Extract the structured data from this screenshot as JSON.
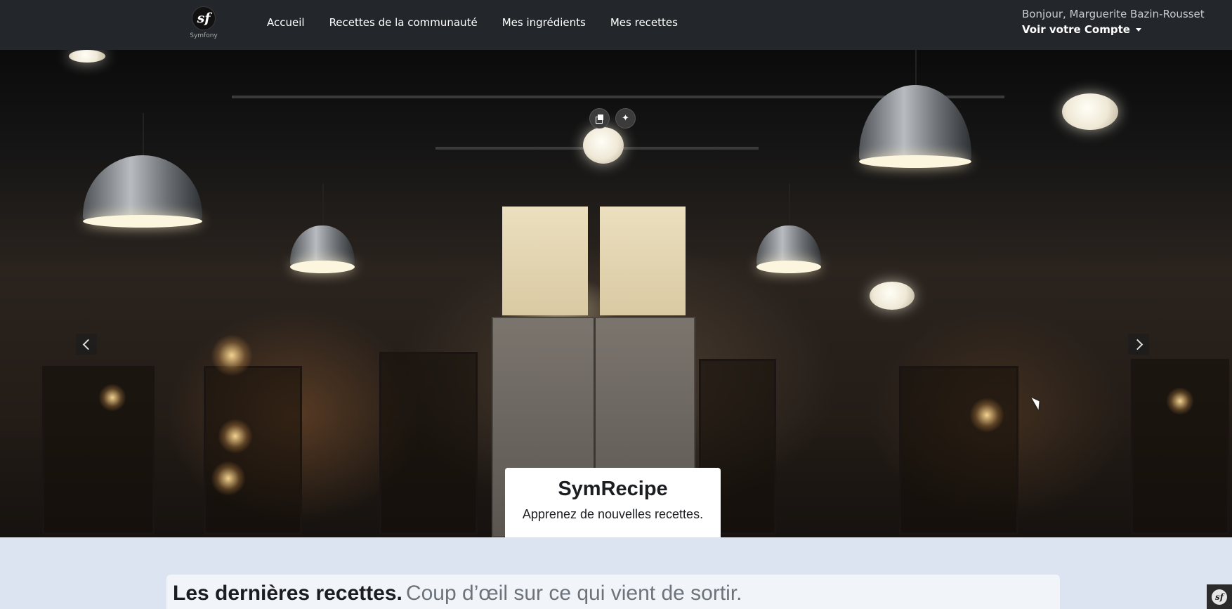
{
  "navbar": {
    "brand": {
      "logo_text": "sf",
      "name": "Symfony"
    },
    "links": [
      {
        "label": "Accueil"
      },
      {
        "label": "Recettes de la communauté"
      },
      {
        "label": "Mes ingrédients"
      },
      {
        "label": "Mes recettes"
      }
    ],
    "user": {
      "greeting": "Bonjour, Marguerite Bazin-Rousset",
      "account_label": "Voir votre Compte"
    }
  },
  "hero": {
    "caption_title": "SymRecipe",
    "caption_subtitle": "Apprenez de nouvelles recettes."
  },
  "latest": {
    "title": "Les dernières recettes.",
    "subtitle": "Coup d’œil sur ce qui vient de sortir."
  },
  "toolbar": {
    "logo_text": "sf"
  },
  "colors": {
    "navbar_bg": "#23272b",
    "page_bg": "#dce4f2",
    "caption_bg": "#ffffff",
    "muted_text": "#6c737a"
  }
}
